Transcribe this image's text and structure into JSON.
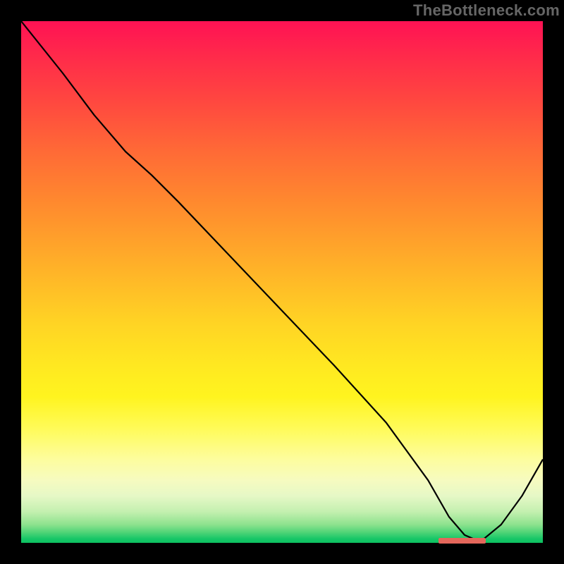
{
  "watermark": "TheBottleneck.com",
  "colors": {
    "gradient_top": "#ff1254",
    "gradient_mid": "#ffe821",
    "gradient_bottom": "#0dc060",
    "curve": "#000000",
    "marker": "#e4675b",
    "frame": "#000000"
  },
  "chart_data": {
    "type": "line",
    "title": "",
    "xlabel": "",
    "ylabel": "",
    "xlim": [
      0,
      100
    ],
    "ylim": [
      0,
      100
    ],
    "grid": false,
    "legend": false,
    "series": [
      {
        "name": "bottleneck-curve",
        "x": [
          0,
          8,
          14,
          20,
          25,
          30,
          40,
          50,
          60,
          70,
          78,
          82,
          85,
          88,
          92,
          96,
          100
        ],
        "y": [
          100,
          90,
          82,
          75,
          70.5,
          65.5,
          55,
          44.5,
          34,
          23,
          12,
          5,
          1.5,
          0.2,
          3.5,
          9,
          16
        ]
      }
    ],
    "annotations": [
      {
        "name": "optimal-marker",
        "x_start": 80,
        "x_end": 89,
        "y": 0.4
      }
    ]
  }
}
